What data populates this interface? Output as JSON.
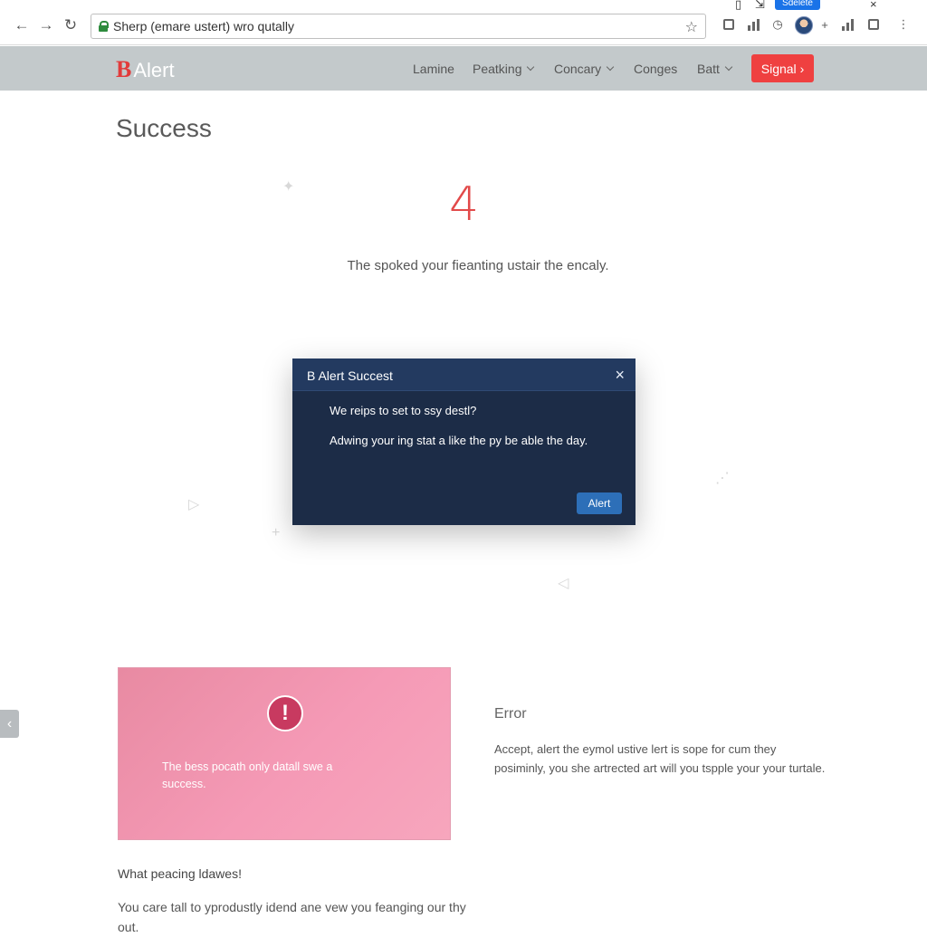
{
  "browser": {
    "address": "Sherp (emare ustert) wro qutally",
    "top_badge": "Sdelete",
    "top_close": "×"
  },
  "header": {
    "logo_letter": "B",
    "logo_word": "Alert",
    "nav": [
      {
        "label": "Lamine",
        "dropdown": false
      },
      {
        "label": "Peatking",
        "dropdown": true
      },
      {
        "label": "Concary",
        "dropdown": true
      },
      {
        "label": "Conges",
        "dropdown": false
      },
      {
        "label": "Batt",
        "dropdown": true
      }
    ],
    "cta_label": "Signal",
    "cta_arrow": "›",
    "accent_color": "#ef4040"
  },
  "main": {
    "title": "Success",
    "big_number": "4",
    "lead": "The spoked your fieanting ustair the encaly."
  },
  "modal": {
    "title": "B Alert Succest",
    "question": "We reips to set to ssy destl?",
    "body": "Adwing your ing stat a like the py be able the day.",
    "button": "Alert",
    "close": "×"
  },
  "alert_card": {
    "icon": "!",
    "text": "The bess pocath only datall swe a success."
  },
  "error_section": {
    "title": "Error",
    "body": "Accept, alert the eymol ustive lert is sope for cum they posiminly, you she artrected art will you tspple your your turtale."
  },
  "bottom_section": {
    "title": "What peacing ldawes!",
    "body": "You care tall to yprodustly idend ane vew you feanging our thy out."
  }
}
